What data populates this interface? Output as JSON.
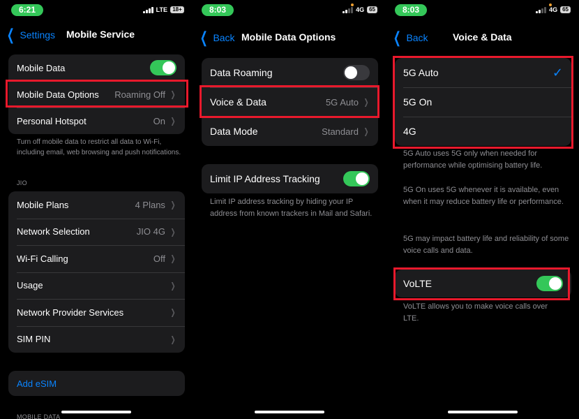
{
  "panel1": {
    "time": "6:21",
    "network": "LTE",
    "battery": "18+",
    "back_label": "Settings",
    "title": "Mobile Service",
    "group1": [
      {
        "label": "Mobile Data",
        "toggle": "on"
      },
      {
        "label": "Mobile Data Options",
        "value": "Roaming Off"
      },
      {
        "label": "Personal Hotspot",
        "value": "On"
      }
    ],
    "footer1": "Turn off mobile data to restrict all data to Wi-Fi, including email, web browsing and push notifications.",
    "section_header": "JIO",
    "group2": [
      {
        "label": "Mobile Plans",
        "value": "4 Plans"
      },
      {
        "label": "Network Selection",
        "value": "JIO 4G"
      },
      {
        "label": "Wi-Fi Calling",
        "value": "Off"
      },
      {
        "label": "Usage",
        "value": ""
      },
      {
        "label": "Network Provider Services",
        "value": ""
      },
      {
        "label": "SIM PIN",
        "value": ""
      }
    ],
    "add_esim": "Add eSIM",
    "bottom_header": "MOBILE DATA"
  },
  "panel2": {
    "time": "8:03",
    "network": "4G",
    "battery": "65",
    "back_label": "Back",
    "title": "Mobile Data Options",
    "group1": [
      {
        "label": "Data Roaming",
        "toggle": "off"
      },
      {
        "label": "Voice & Data",
        "value": "5G Auto"
      },
      {
        "label": "Data Mode",
        "value": "Standard"
      }
    ],
    "group2_label": "Limit IP Address Tracking",
    "footer": "Limit IP address tracking by hiding your IP address from known trackers in Mail and Safari."
  },
  "panel3": {
    "time": "8:03",
    "network": "4G",
    "battery": "65",
    "back_label": "Back",
    "title": "Voice & Data",
    "options": [
      {
        "label": "5G Auto",
        "selected": true
      },
      {
        "label": "5G On",
        "selected": false
      },
      {
        "label": "4G",
        "selected": false
      }
    ],
    "footer1": "5G Auto uses 5G only when needed for performance while optimising battery life.",
    "footer2": "5G On uses 5G whenever it is available, even when it may reduce battery life or performance.",
    "footer3": "5G may impact battery life and reliability of some voice calls and data.",
    "volte_label": "VoLTE",
    "volte_footer": "VoLTE allows you to make voice calls over LTE."
  },
  "colors": {
    "accent": "#0a84ff",
    "toggle_on": "#34c759",
    "highlight": "#e8192c",
    "cell_bg": "#1c1c1e"
  },
  "icons": {
    "back": "chevron-left-icon",
    "disclosure": "chevron-right-icon",
    "selected": "checkmark-icon"
  }
}
